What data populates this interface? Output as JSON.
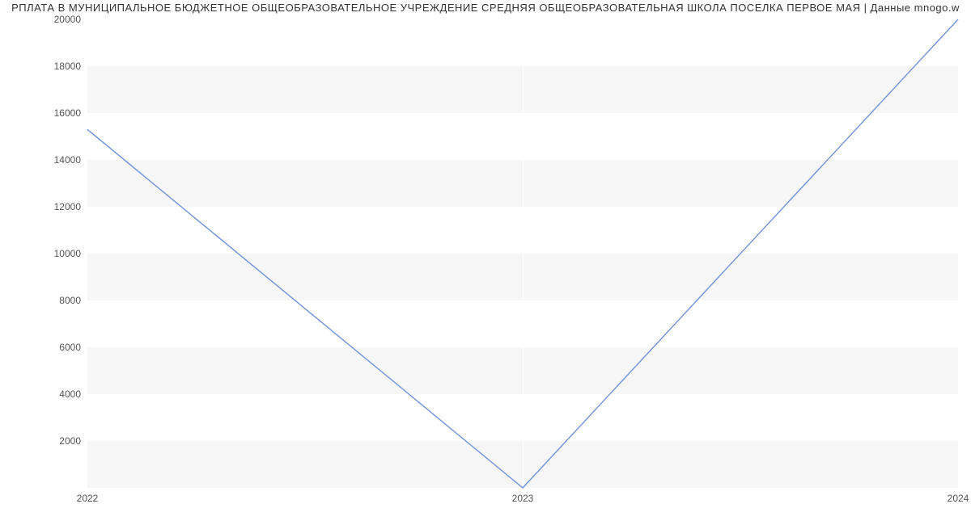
{
  "chart_data": {
    "type": "line",
    "title": "РПЛАТА В МУНИЦИПАЛЬНОЕ БЮДЖЕТНОЕ ОБЩЕОБРАЗОВАТЕЛЬНОЕ УЧРЕЖДЕНИЕ СРЕДНЯЯ ОБЩЕОБРАЗОВАТЕЛЬНАЯ ШКОЛА ПОСЕЛКА ПЕРВОЕ МАЯ | Данные mnogo.w",
    "x": [
      2022,
      2023,
      2024
    ],
    "values": [
      15300,
      0,
      20000
    ],
    "xlabel": "",
    "ylabel": "",
    "xlim": [
      2022,
      2024
    ],
    "ylim": [
      0,
      20000
    ],
    "y_ticks": [
      2000,
      4000,
      6000,
      8000,
      10000,
      12000,
      14000,
      16000,
      18000,
      20000
    ],
    "x_ticks": [
      2022,
      2023,
      2024
    ],
    "line_color": "#6f94d8"
  }
}
